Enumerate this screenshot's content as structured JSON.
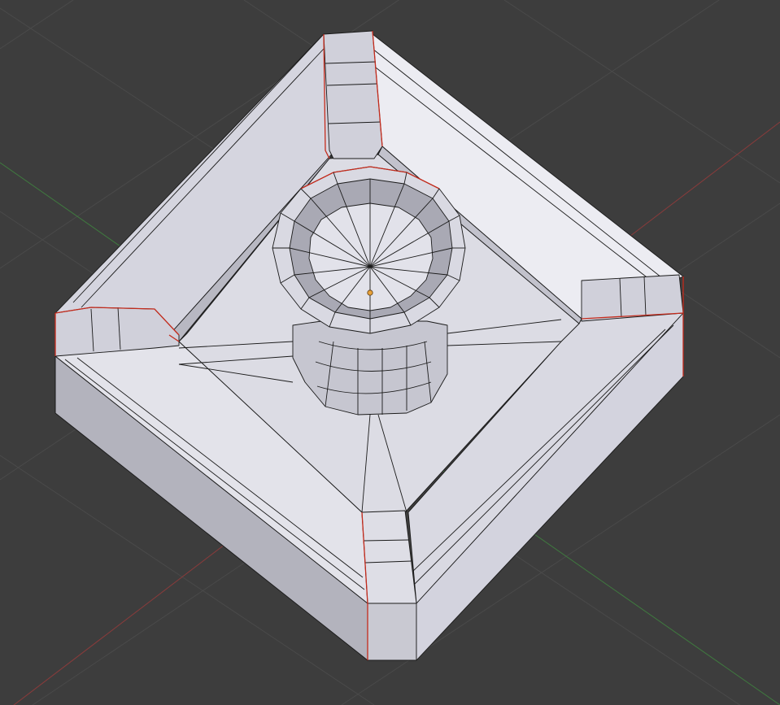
{
  "viewport": {
    "background": "#3d3d3d",
    "grid_color": "#4a4a4a",
    "x_axis_color": "#8a3b3b",
    "y_axis_color": "#3f7a3f"
  },
  "mesh": {
    "face_color": "#d9d9e2",
    "face_light": "#ececf2",
    "face_shadow": "#b3b3bd",
    "face_dark": "#9a9aa4",
    "edge_color": "#1a1a1a",
    "seam_color": "#c42b1c"
  },
  "origin": {
    "color": "#e8a13a",
    "icon": "object-origin-icon"
  }
}
